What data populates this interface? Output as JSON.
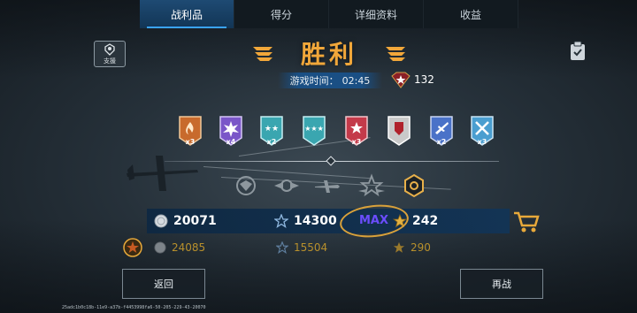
{
  "tabs": [
    {
      "label": "战利品",
      "active": true
    },
    {
      "label": "得分",
      "active": false
    },
    {
      "label": "详细资料",
      "active": false
    },
    {
      "label": "收益",
      "active": false
    }
  ],
  "support_button": {
    "label": "支援",
    "icon": "support-icon"
  },
  "clipboard_icon": "clipboard-check-icon",
  "header": {
    "title": "胜利",
    "game_time_label": "游戏时间：",
    "game_time_value": "02:45",
    "rank_points": "132"
  },
  "medals": [
    {
      "icon": "flame-medal-icon",
      "multiplier": "x3",
      "color": "#c86a2c"
    },
    {
      "icon": "explosion-medal-icon",
      "multiplier": "x4",
      "color": "#7a56c8"
    },
    {
      "icon": "two-stars-medal-icon",
      "multiplier": "x2",
      "color": "#3aa6b0"
    },
    {
      "icon": "three-stars-medal-icon",
      "multiplier": "",
      "color": "#3aa6b0"
    },
    {
      "icon": "star-wings-medal-icon",
      "multiplier": "x3",
      "color": "#c43a4a"
    },
    {
      "icon": "shield-medal-icon",
      "multiplier": "",
      "color": "#c9c9c9"
    },
    {
      "icon": "plane-medal-icon",
      "multiplier": "x2",
      "color": "#4a72c8"
    },
    {
      "icon": "crossed-planes-medal-icon",
      "multiplier": "x3",
      "color": "#4a9ed0"
    }
  ],
  "achievements": [
    {
      "icon": "eagle-wreath-icon"
    },
    {
      "icon": "winged-emblem-icon"
    },
    {
      "icon": "airplane-icon"
    },
    {
      "icon": "star-wings-icon"
    },
    {
      "icon": "gold-hexagon-badge-icon"
    }
  ],
  "scores": {
    "main": {
      "silver": "20071",
      "experience": "14300",
      "max_tag": "MAX",
      "stars": "242"
    },
    "premium": {
      "silver": "24085",
      "experience": "15504",
      "stars": "290"
    }
  },
  "buttons": {
    "back": "返回",
    "again": "再战"
  },
  "footer_id": "25adc1b0c18b-11e9-a37b-f4453998fa6-50-205-229-43-20070",
  "colors": {
    "accent": "#f1a73a",
    "tab_active": "#1e4a73",
    "max": "#6b4dff",
    "premium_text": "#b8902c"
  }
}
